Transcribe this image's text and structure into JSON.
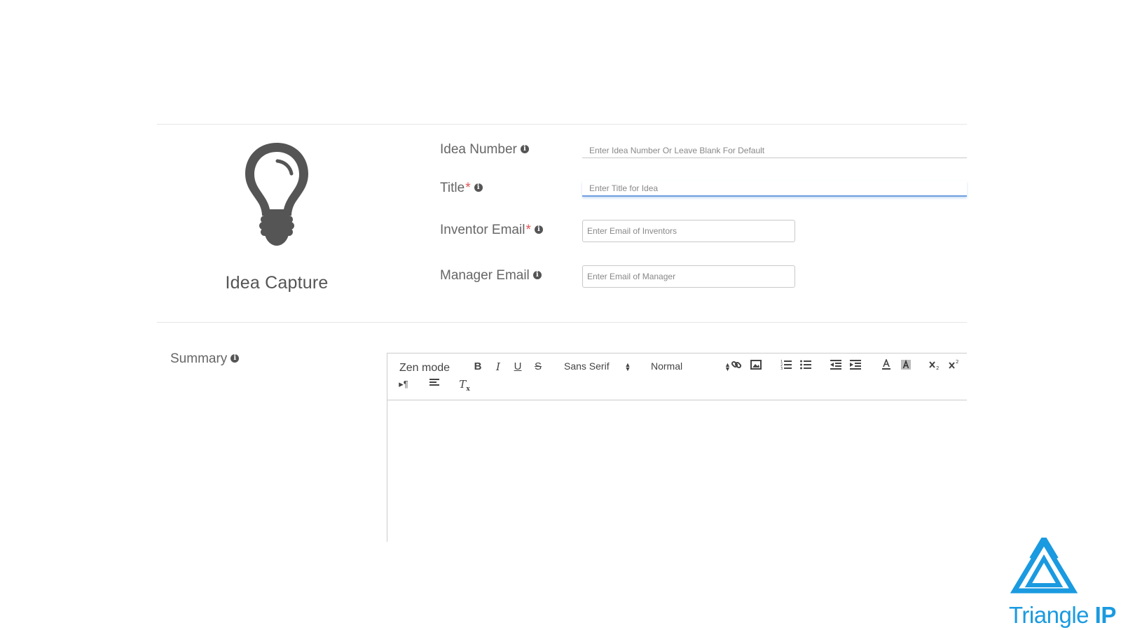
{
  "idea_panel": {
    "caption": "Idea Capture",
    "icon": "lightbulb-icon"
  },
  "fields": {
    "idea_number": {
      "label": "Idea Number",
      "placeholder": "Enter Idea Number Or Leave Blank For Default"
    },
    "title": {
      "label": "Title",
      "required_mark": "*",
      "placeholder": "Enter Title for Idea"
    },
    "inventor_email": {
      "label": "Inventor Email",
      "required_mark": "*",
      "placeholder": "Enter Email of Inventors"
    },
    "manager_email": {
      "label": "Manager Email",
      "placeholder": "Enter Email of Manager"
    }
  },
  "summary": {
    "label": "Summary"
  },
  "toolbar": {
    "zen_mode": "Zen mode",
    "bold": "B",
    "italic": "I",
    "underline": "U",
    "strike": "S",
    "font_family": "Sans Serif",
    "font_size": "Normal",
    "rtl": "▸¶",
    "clear_format": "T"
  },
  "logo": {
    "name_regular": "Triangle ",
    "name_bold": "IP"
  },
  "colors": {
    "accent_blue": "#1a9ae0",
    "focus_blue": "#6d9fe0",
    "required_red": "#e35454",
    "icon_gray": "#555555"
  }
}
